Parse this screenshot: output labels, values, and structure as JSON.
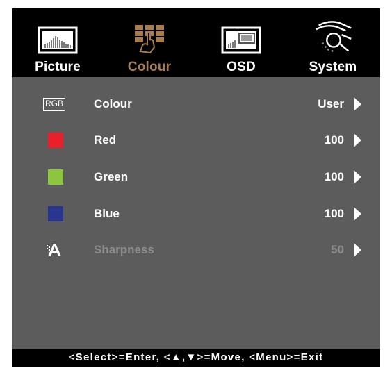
{
  "tabs": [
    {
      "label": "Picture",
      "icon": "picture-icon",
      "active": false
    },
    {
      "label": "Colour",
      "icon": "colour-icon",
      "active": true
    },
    {
      "label": "OSD",
      "icon": "osd-icon",
      "active": false
    },
    {
      "label": "System",
      "icon": "system-icon",
      "active": false
    }
  ],
  "colours": {
    "accent_active_tab": "#a87c4f",
    "panel_bg": "#5c5c5c",
    "red_swatch": "#e8202a",
    "green_swatch": "#8cc63f",
    "blue_swatch": "#2a3590",
    "disabled_text": "#8c8c8c"
  },
  "menu": {
    "rows": [
      {
        "icon": "rgb-icon",
        "icon_text": "RGB",
        "label": "Colour",
        "value": "User",
        "enabled": true
      },
      {
        "icon": "red-swatch-icon",
        "label": "Red",
        "value": "100",
        "enabled": true
      },
      {
        "icon": "green-swatch-icon",
        "label": "Green",
        "value": "100",
        "enabled": true
      },
      {
        "icon": "blue-swatch-icon",
        "label": "Blue",
        "value": "100",
        "enabled": true
      },
      {
        "icon": "sharpness-icon",
        "label": "Sharpness",
        "value": "50",
        "enabled": false
      }
    ]
  },
  "footer": {
    "hint": "<Select>=Enter, <▲,▼>=Move, <Menu>=Exit"
  }
}
